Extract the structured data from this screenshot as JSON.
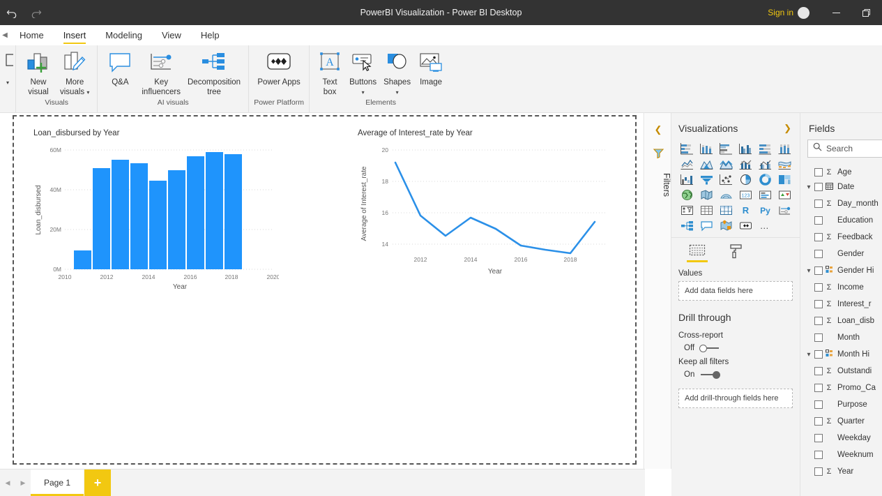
{
  "titlebar": {
    "undo_icon": "undo-arrow",
    "redo_icon": "redo-arrow",
    "title": "PowerBI Visualization - Power BI Desktop",
    "signin": "Sign in",
    "minimize": "—",
    "restore": "restore-window"
  },
  "ribbon": {
    "tabs": [
      {
        "label": "Home",
        "active": false
      },
      {
        "label": "Insert",
        "active": true
      },
      {
        "label": "Modeling",
        "active": false
      },
      {
        "label": "View",
        "active": false
      },
      {
        "label": "Help",
        "active": false
      }
    ],
    "groups": [
      {
        "name": "Visuals",
        "label": "Visuals",
        "items": [
          {
            "label1": "New",
            "label2": "visual",
            "icon": "new-visual-icon",
            "caret": false
          },
          {
            "label1": "More",
            "label2": "visuals",
            "icon": "more-visuals-icon",
            "caret": true
          }
        ]
      },
      {
        "name": "AI visuals",
        "label": "AI visuals",
        "items": [
          {
            "label1": "Q&A",
            "label2": "",
            "icon": "qna-icon",
            "caret": false
          },
          {
            "label1": "Key",
            "label2": "influencers",
            "icon": "key-influencers-icon",
            "caret": false
          },
          {
            "label1": "Decomposition",
            "label2": "tree",
            "icon": "decomposition-tree-icon",
            "caret": false
          }
        ]
      },
      {
        "name": "Power Platform",
        "label": "Power Platform",
        "items": [
          {
            "label1": "Power Apps",
            "label2": "",
            "icon": "power-apps-icon",
            "caret": false
          }
        ]
      },
      {
        "name": "Elements",
        "label": "Elements",
        "items": [
          {
            "label1": "Text",
            "label2": "box",
            "icon": "text-box-icon",
            "caret": false
          },
          {
            "label1": "Buttons",
            "label2": "",
            "icon": "buttons-icon",
            "caret": true
          },
          {
            "label1": "Shapes",
            "label2": "",
            "icon": "shapes-icon",
            "caret": true
          },
          {
            "label1": "Image",
            "label2": "",
            "icon": "image-icon",
            "caret": false
          }
        ]
      }
    ]
  },
  "filters": {
    "label": "Filters",
    "chevron": "chevron-left-icon",
    "icon": "filter-funnel-icon"
  },
  "visualizations": {
    "title": "Visualizations",
    "chevron": "chevron-right-icon",
    "gallery_icons": [
      "stacked-bar-chart",
      "stacked-column-chart",
      "clustered-bar-chart",
      "clustered-column-chart",
      "100-stacked-bar-chart",
      "100-stacked-column-chart",
      "line-chart",
      "area-chart",
      "stacked-area-chart",
      "line-and-stacked-column-chart",
      "line-and-clustered-column-chart",
      "ribbon-chart",
      "waterfall-chart",
      "funnel-chart",
      "scatter-chart",
      "pie-chart",
      "donut-chart",
      "treemap",
      "map",
      "filled-map",
      "arcgis-map",
      "card",
      "multi-row-card",
      "kpi",
      "slicer",
      "table",
      "matrix",
      "r-script-visual",
      "python-visual",
      "key-influencers",
      "decomposition-tree",
      "qna-visual",
      "smart-narrative",
      "paginated-report",
      "more-options"
    ],
    "pane_tabs": [
      {
        "name": "fields-tab",
        "icon": "fields-pane-icon",
        "active": true
      },
      {
        "name": "format-tab",
        "icon": "paint-roller-icon",
        "active": false
      }
    ],
    "values_label": "Values",
    "values_placeholder": "Add data fields here",
    "drillthrough_title": "Drill through",
    "crossreport_label": "Cross-report",
    "crossreport_state": "Off",
    "keepallfilters_label": "Keep all filters",
    "keepallfilters_state": "On",
    "drillthrough_placeholder": "Add drill-through fields here"
  },
  "fields": {
    "title": "Fields",
    "search_placeholder": "Search",
    "search_icon": "search-icon",
    "items": [
      {
        "label": "Age",
        "expand": false,
        "sigma": true,
        "icon": ""
      },
      {
        "label": "Date",
        "expand": true,
        "sigma": false,
        "icon": "calendar-icon"
      },
      {
        "label": "Day_month",
        "expand": false,
        "sigma": true,
        "icon": ""
      },
      {
        "label": "Education",
        "expand": false,
        "sigma": false,
        "icon": ""
      },
      {
        "label": "Feedback",
        "expand": false,
        "sigma": true,
        "icon": ""
      },
      {
        "label": "Gender",
        "expand": false,
        "sigma": false,
        "icon": ""
      },
      {
        "label": "Gender Hi",
        "expand": true,
        "sigma": false,
        "icon": "hierarchy-icon"
      },
      {
        "label": "Income",
        "expand": false,
        "sigma": true,
        "icon": ""
      },
      {
        "label": "Interest_r",
        "expand": false,
        "sigma": true,
        "icon": ""
      },
      {
        "label": "Loan_disb",
        "expand": false,
        "sigma": true,
        "icon": ""
      },
      {
        "label": "Month",
        "expand": false,
        "sigma": false,
        "icon": ""
      },
      {
        "label": "Month Hi",
        "expand": true,
        "sigma": false,
        "icon": "hierarchy-icon"
      },
      {
        "label": "Outstandi",
        "expand": false,
        "sigma": true,
        "icon": ""
      },
      {
        "label": "Promo_Ca",
        "expand": false,
        "sigma": true,
        "icon": ""
      },
      {
        "label": "Purpose",
        "expand": false,
        "sigma": false,
        "icon": ""
      },
      {
        "label": "Quarter",
        "expand": false,
        "sigma": true,
        "icon": ""
      },
      {
        "label": "Weekday",
        "expand": false,
        "sigma": false,
        "icon": ""
      },
      {
        "label": "Weeknum",
        "expand": false,
        "sigma": false,
        "icon": ""
      },
      {
        "label": "Year",
        "expand": false,
        "sigma": true,
        "icon": ""
      }
    ]
  },
  "pagebar": {
    "prev_icon": "prev-page-icon",
    "next_icon": "next-page-icon",
    "tab_label": "Page 1",
    "add_label": "+"
  },
  "chart_data": [
    {
      "type": "bar",
      "title": "Loan_disbursed by Year",
      "xlabel": "Year",
      "ylabel": "Loan_disbursed",
      "categories": [
        2011,
        2012,
        2013,
        2014,
        2015,
        2016,
        2017,
        2018,
        2019
      ],
      "values": [
        9.5,
        51.0,
        55.0,
        53.5,
        44.5,
        50.0,
        57.0,
        59.0,
        58.0
      ],
      "value_unit": "M",
      "ylim": [
        0,
        60
      ],
      "yticks": [
        0,
        20,
        40,
        60
      ],
      "ytick_labels": [
        "0M",
        "20M",
        "40M",
        "60M"
      ],
      "xlim": [
        2010,
        2020
      ],
      "xticks": [
        2010,
        2012,
        2014,
        2016,
        2018,
        2020
      ],
      "xtick_labels": [
        "2010",
        "2012",
        "2014",
        "2016",
        "2018",
        "2020"
      ],
      "grid": true,
      "legend": "none",
      "color": "#1f94fc"
    },
    {
      "type": "line",
      "title": "Average of Interest_rate by Year",
      "xlabel": "Year",
      "ylabel": "Average of Interest_rate",
      "x": [
        2011,
        2012,
        2013,
        2014,
        2015,
        2016,
        2017,
        2018,
        2019
      ],
      "values": [
        19.2,
        15.8,
        14.5,
        15.7,
        15.0,
        13.9,
        13.6,
        13.4,
        15.5
      ],
      "ylim": [
        13.2,
        20
      ],
      "yticks": [
        14,
        16,
        18,
        20
      ],
      "ytick_labels": [
        "14",
        "16",
        "18",
        "20"
      ],
      "xlim": [
        2011,
        2019
      ],
      "xticks": [
        2012,
        2014,
        2016,
        2018
      ],
      "xtick_labels": [
        "2012",
        "2014",
        "2016",
        "2018"
      ],
      "grid": true,
      "legend": "none",
      "color": "#2b90e8"
    }
  ]
}
